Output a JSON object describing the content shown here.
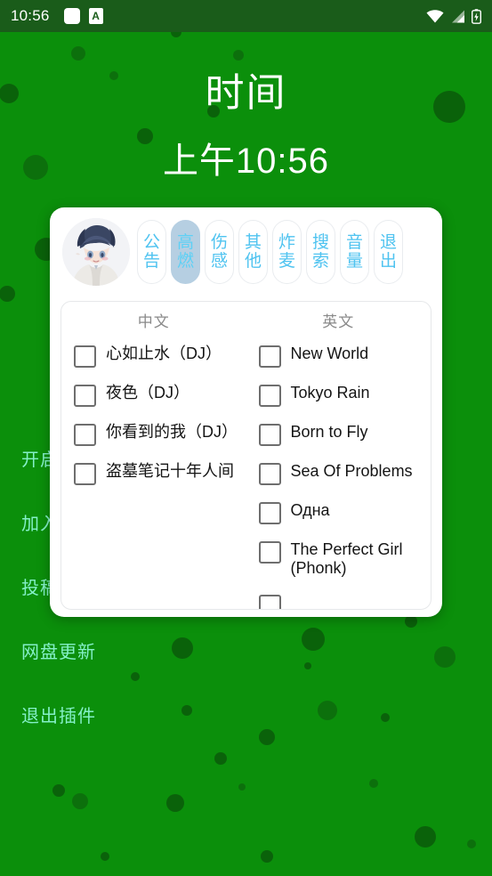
{
  "status_bar": {
    "time": "10:56",
    "icons": [
      "blank-square-icon",
      "a-letter-icon"
    ],
    "a_glyph": "A",
    "right_icons": [
      "wifi-icon",
      "cellular-signal-icon",
      "battery-charging-icon"
    ]
  },
  "page": {
    "title": "时间",
    "subtitle": "上午10:56",
    "background_color": "#0b8f0b",
    "title_color": "#ffffff"
  },
  "side_menu": {
    "items": [
      {
        "label": "开启悬浮窗"
      },
      {
        "label": "加入频道"
      },
      {
        "label": "投稿反馈"
      },
      {
        "label": "网盘更新"
      },
      {
        "label": "退出插件"
      }
    ],
    "text_color": "#84f0c8"
  },
  "dialog": {
    "avatar": "anime-boy-avatar",
    "accent_color": "#4fc3f0",
    "selected_tab_bg": "#b6cfe2",
    "tabs": [
      {
        "label": "公告",
        "c1": "公",
        "c2": "告",
        "selected": false
      },
      {
        "label": "高燃",
        "c1": "高",
        "c2": "燃",
        "selected": true
      },
      {
        "label": "伤感",
        "c1": "伤",
        "c2": "感",
        "selected": false
      },
      {
        "label": "其他",
        "c1": "其",
        "c2": "他",
        "selected": false
      },
      {
        "label": "炸麦",
        "c1": "炸",
        "c2": "麦",
        "selected": false
      },
      {
        "label": "搜索",
        "c1": "搜",
        "c2": "索",
        "selected": false
      },
      {
        "label": "音量",
        "c1": "音",
        "c2": "量",
        "selected": false
      },
      {
        "label": "退出",
        "c1": "退",
        "c2": "出",
        "selected": false
      }
    ],
    "columns": [
      {
        "title": "中文",
        "items": [
          {
            "label": "心如止水（DJ）",
            "checked": false
          },
          {
            "label": "夜色（DJ）",
            "checked": false
          },
          {
            "label": "你看到的我（DJ）",
            "checked": false
          },
          {
            "label": "盗墓笔记十年人间",
            "checked": false
          }
        ]
      },
      {
        "title": "英文",
        "items": [
          {
            "label": "New World",
            "checked": false
          },
          {
            "label": "Tokyo Rain",
            "checked": false
          },
          {
            "label": "Born to Fly",
            "checked": false
          },
          {
            "label": "Sea Of Problems",
            "checked": false
          },
          {
            "label": "Одна",
            "checked": false
          },
          {
            "label": "The Perfect Girl (Phonk)",
            "checked": false
          }
        ]
      }
    ]
  }
}
